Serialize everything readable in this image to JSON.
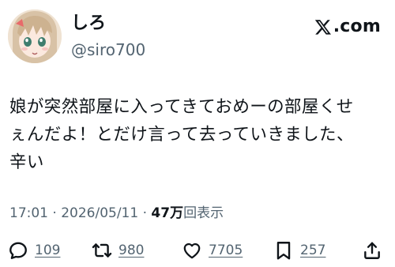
{
  "user": {
    "display_name": "しろ",
    "handle": "@siro700"
  },
  "brand": {
    "text": ".com"
  },
  "tweet": {
    "lines": [
      "娘が突然部屋に入ってきておめーの部屋くせ",
      "ぇんだよ！とだけ言って去っていきました、",
      "辛い"
    ]
  },
  "meta": {
    "timestamp": "17:01 · 2026/05/11 · ",
    "views_count": "47万",
    "views_label": "回表示"
  },
  "actions": {
    "replies": "109",
    "retweets": "980",
    "likes": "7705",
    "bookmarks": "257"
  },
  "icons": {
    "avatar": "anime-girl-avatar",
    "brand": "x-logo-icon",
    "reply": "reply-icon",
    "retweet": "retweet-icon",
    "like": "heart-icon",
    "bookmark": "bookmark-icon",
    "share": "share-icon"
  },
  "colors": {
    "text": "#0f1419",
    "secondary": "#536471",
    "background": "#ffffff"
  }
}
